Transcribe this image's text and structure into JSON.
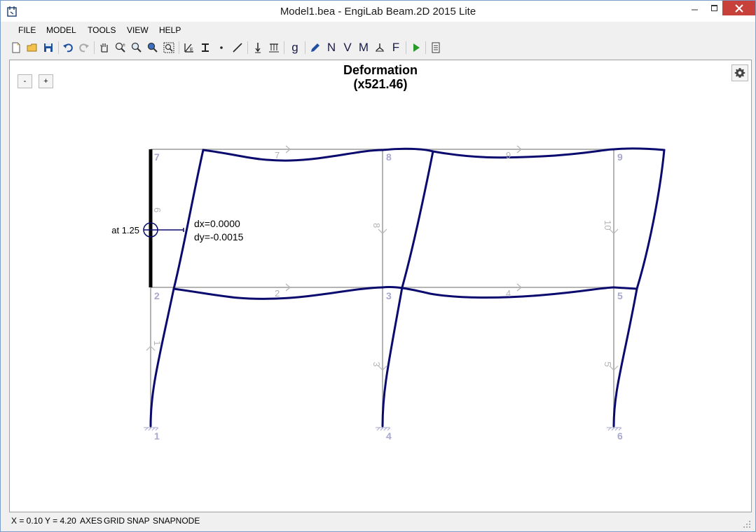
{
  "window": {
    "title": "Model1.bea - EngiLab Beam.2D 2015 Lite"
  },
  "menu": {
    "file": "FILE",
    "model": "MODEL",
    "tools": "TOOLS",
    "view": "VIEW",
    "help": "HELP"
  },
  "toolbar": {
    "letters": {
      "g": "g",
      "n": "N",
      "v": "V",
      "m": "M",
      "f": "F"
    }
  },
  "canvas": {
    "zoom_out": "-",
    "zoom_in": "+",
    "title_line1": "Deformation",
    "title_line2": "(x521.46)"
  },
  "diagram": {
    "nodes": [
      "1",
      "2",
      "3",
      "4",
      "5",
      "6",
      "7",
      "8",
      "9"
    ],
    "elements": [
      "1",
      "2",
      "3",
      "4",
      "5",
      "6",
      "7",
      "8",
      "9",
      "10"
    ],
    "probe": {
      "position_label": "at 1.25",
      "dx": "dx=0.0000",
      "dy": "dy=-0.0015"
    },
    "colors": {
      "deformed": "#0a0a6e",
      "undeformed": "#b4b4b4",
      "labels": "#a8a8d0",
      "selected": "#000000"
    }
  },
  "status": {
    "x": "X = 0.10",
    "y": "Y = 4.20",
    "axes": "AXES",
    "grid": "GRID",
    "snap": "SNAP",
    "snapnode": "SNAPNODE"
  }
}
